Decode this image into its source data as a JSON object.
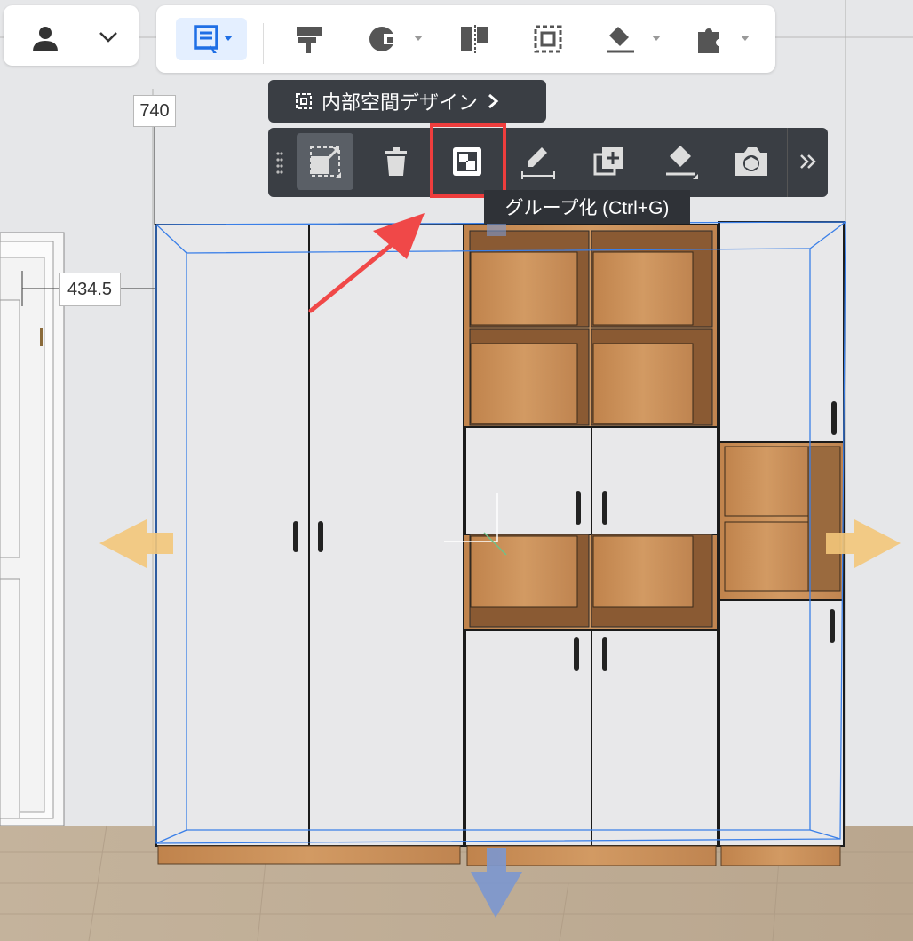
{
  "user_menu": {
    "avatar_icon": "user-icon",
    "chevron_icon": "chevron-down-icon"
  },
  "toolbar": {
    "accent_color": "#1f6fe5",
    "items": [
      {
        "name": "select-tool",
        "icon": "select-cursor-icon",
        "active": true
      },
      {
        "name": "paint-roller",
        "icon": "paint-roller-icon"
      },
      {
        "name": "material",
        "icon": "material-palette-icon"
      },
      {
        "name": "flip",
        "icon": "flip-icon"
      },
      {
        "name": "frame",
        "icon": "frame-select-icon"
      },
      {
        "name": "eraser",
        "icon": "eraser-icon"
      },
      {
        "name": "plugin",
        "icon": "puzzle-icon"
      }
    ]
  },
  "interior_chip": {
    "label": "内部空間デザイン"
  },
  "context_bar": {
    "items": [
      {
        "name": "scale",
        "icon": "scale-icon",
        "selected": true
      },
      {
        "name": "delete",
        "icon": "trash-icon"
      },
      {
        "name": "group",
        "icon": "group-icon"
      },
      {
        "name": "measure",
        "icon": "measure-icon"
      },
      {
        "name": "duplicate",
        "icon": "duplicate-icon"
      },
      {
        "name": "material-brush",
        "icon": "material-brush-icon"
      },
      {
        "name": "snapshot",
        "icon": "camera-icon"
      },
      {
        "name": "more",
        "icon": "double-chevron-right-icon"
      }
    ]
  },
  "tooltip": {
    "text": "グループ化 (Ctrl+G)"
  },
  "dimensions": {
    "height_label": "740",
    "offset_label": "434.5"
  },
  "colors": {
    "highlight": "#ee3d3d",
    "move_arrow_x": "#f3c77a",
    "move_arrow_y": "#7b97cf",
    "wood": "#c98d57",
    "panel": "#e9e9eb"
  }
}
